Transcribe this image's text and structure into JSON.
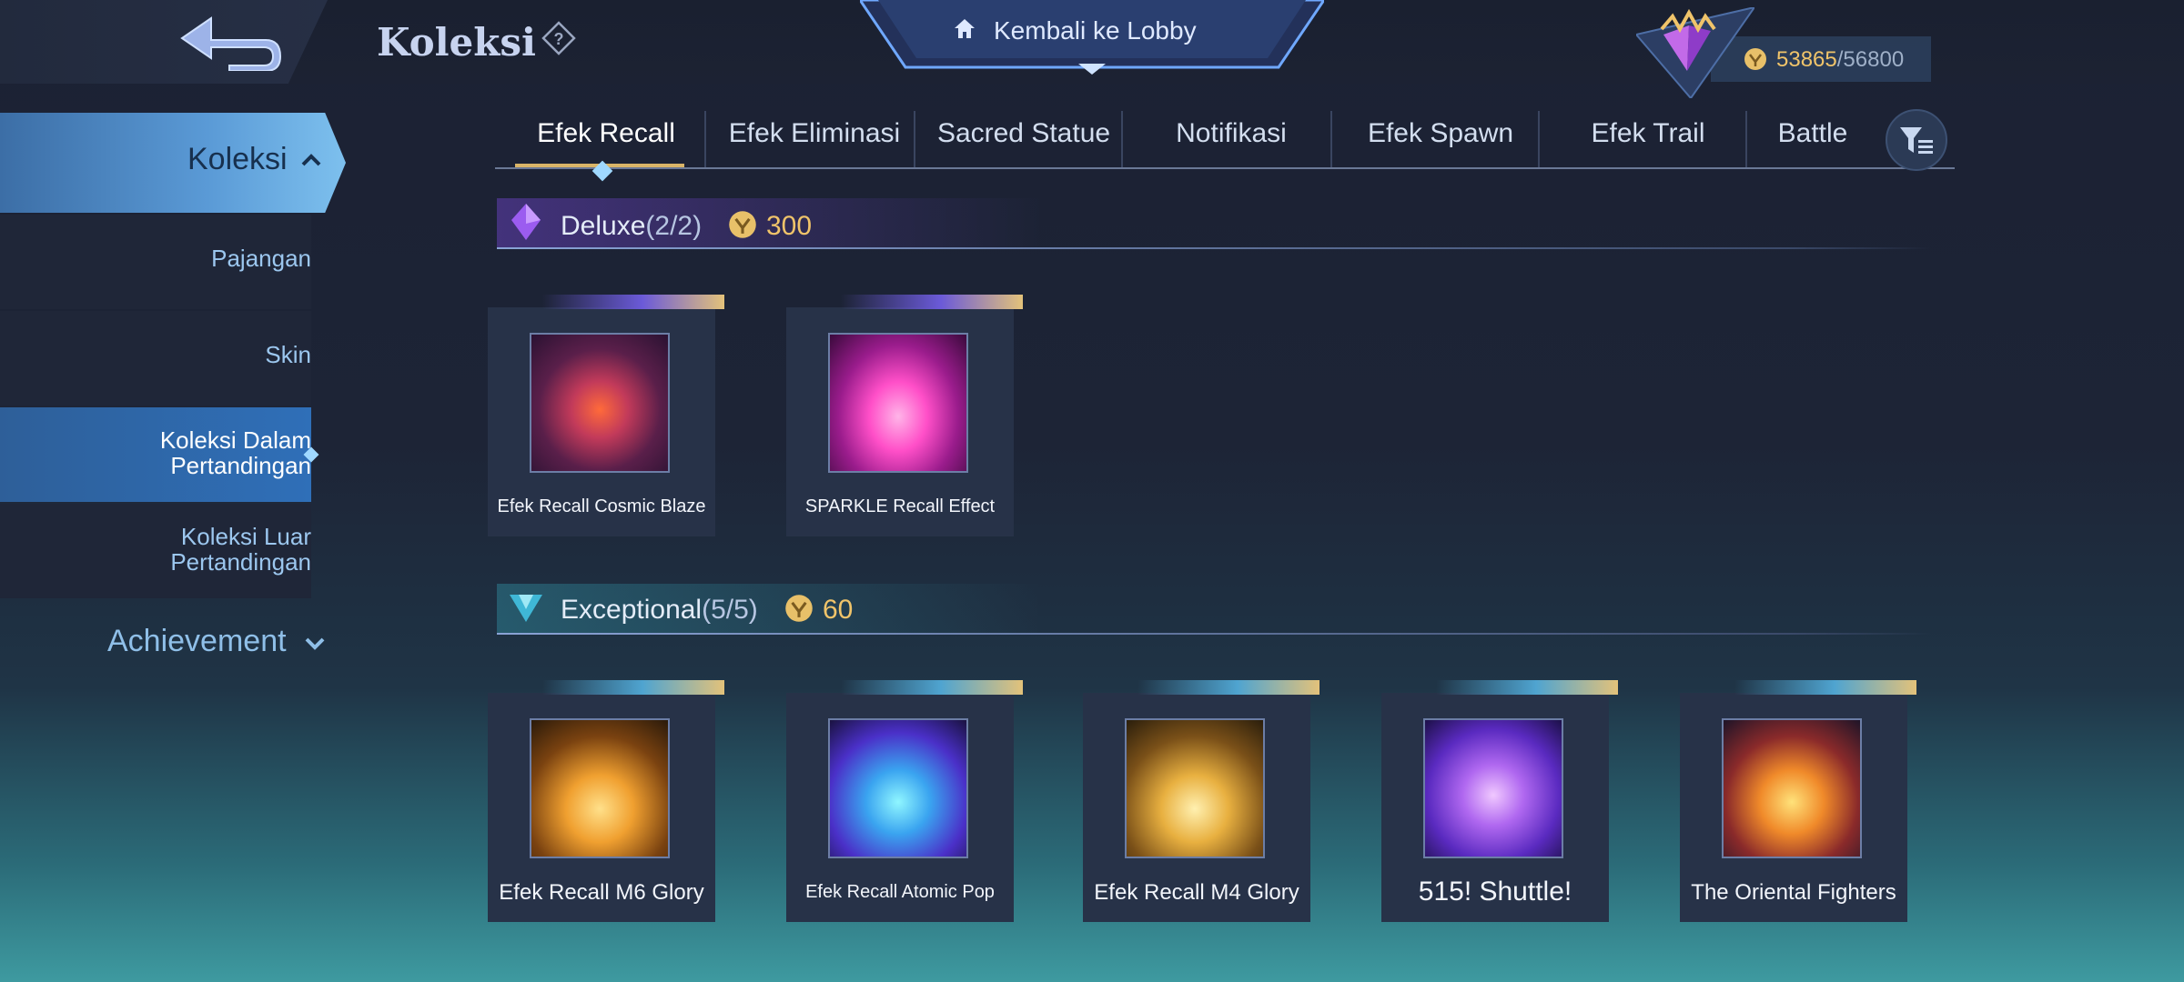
{
  "header": {
    "title": "Koleksi",
    "lobby_label": "Kembali ke Lobby",
    "currency_current": "53865",
    "currency_sep": "/",
    "currency_max": "56800"
  },
  "sidebar": {
    "section_label": "Koleksi",
    "items": [
      {
        "label": "Pajangan"
      },
      {
        "label": "Skin"
      },
      {
        "label": "Koleksi Dalam Pertandingan"
      },
      {
        "label": "Koleksi Luar Pertandingan"
      }
    ],
    "achievement_label": "Achievement"
  },
  "tabs": [
    {
      "label": "Efek Recall"
    },
    {
      "label": "Efek Eliminasi"
    },
    {
      "label": "Sacred Statue"
    },
    {
      "label": "Notifikasi"
    },
    {
      "label": "Efek Spawn"
    },
    {
      "label": "Efek Trail"
    },
    {
      "label": "Battle"
    }
  ],
  "sections": [
    {
      "title": "Deluxe",
      "count": "(2/2)",
      "price": "300",
      "items": [
        {
          "label": "Efek Recall Cosmic Blaze"
        },
        {
          "label": "SPARKLE Recall Effect"
        }
      ]
    },
    {
      "title": "Exceptional",
      "count": "(5/5)",
      "price": "60",
      "items": [
        {
          "label": "Efek Recall M6 Glory"
        },
        {
          "label": "Efek Recall Atomic Pop"
        },
        {
          "label": "Efek Recall M4 Glory"
        },
        {
          "label": "515! Shuttle!"
        },
        {
          "label": "The Oriental Fighters"
        }
      ]
    }
  ],
  "colors": {
    "accent_gold": "#f0c46a",
    "active_blue": "#2f6fb8",
    "deluxe_purple": "#8c50ff",
    "exceptional_cyan": "#3cc8dc"
  }
}
